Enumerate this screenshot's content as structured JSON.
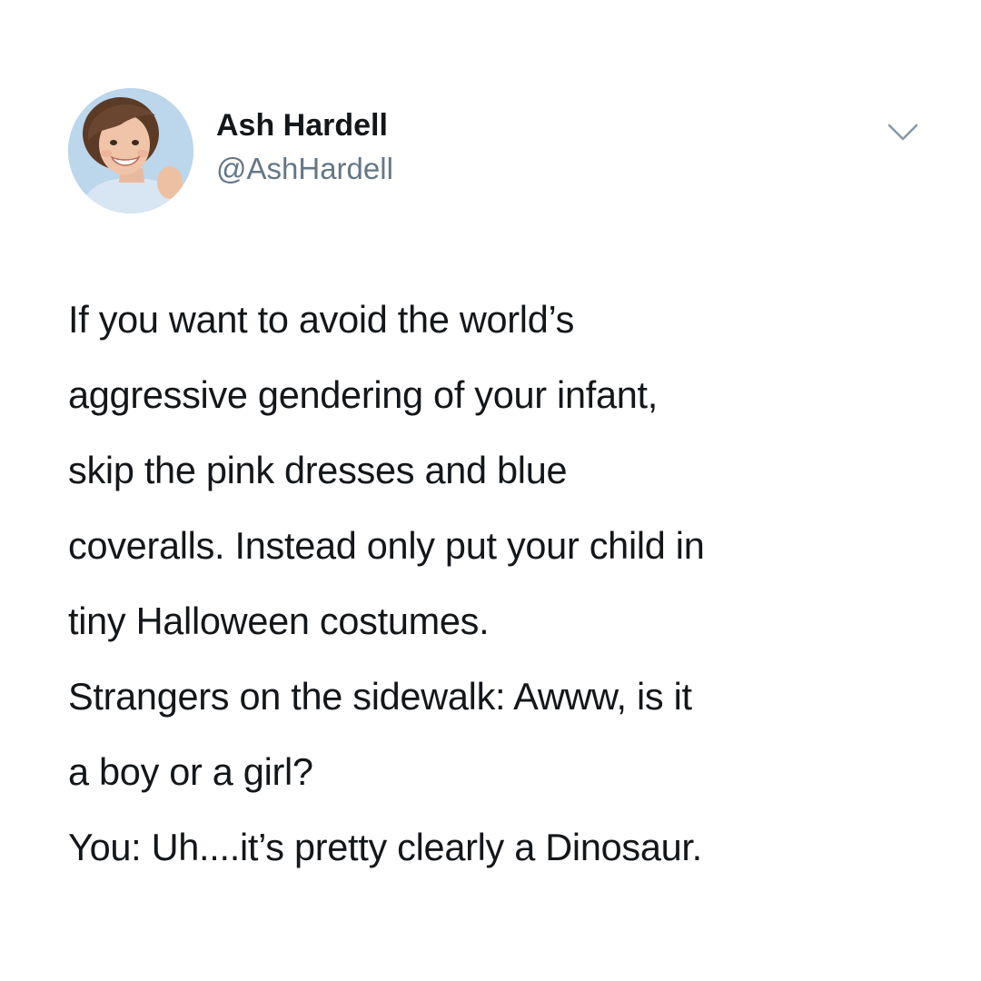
{
  "author": {
    "display_name": "Ash Hardell",
    "handle": "@AshHardell"
  },
  "icons": {
    "avatar": "profile-photo",
    "caret": "chevron-down-icon"
  },
  "colors": {
    "text_primary": "#14171a",
    "text_secondary": "#657786",
    "background": "#ffffff"
  },
  "tweet": {
    "lines": [
      "If you want to avoid the world’s",
      "aggressive gendering of your infant,",
      "skip the pink dresses and blue",
      "coveralls. Instead only put your child in",
      "tiny Halloween costumes.",
      "Strangers on the sidewalk: Awww, is it",
      "a boy or a girl?",
      "You: Uh....it’s pretty clearly a Dinosaur."
    ]
  }
}
